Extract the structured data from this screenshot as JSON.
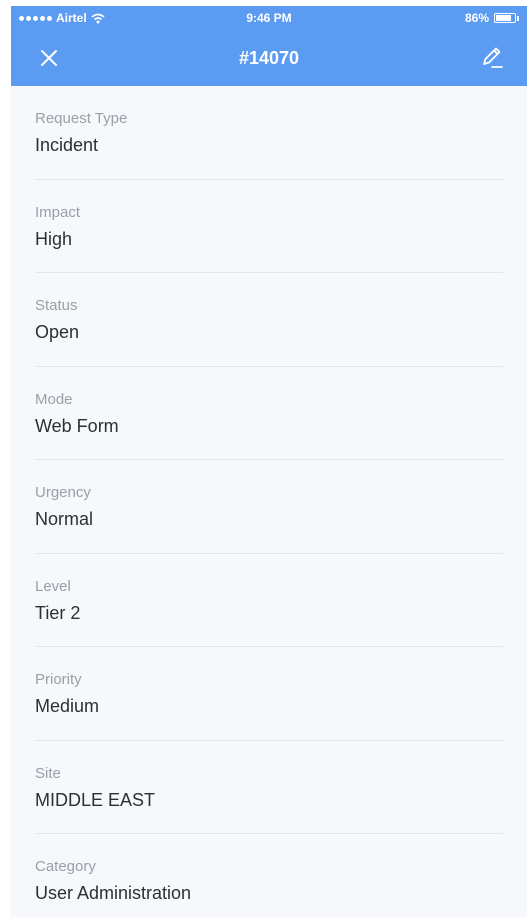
{
  "status_bar": {
    "carrier": "Airtel",
    "time": "9:46 PM",
    "battery": "86%",
    "battery_level": 0.86
  },
  "header": {
    "title": "#14070",
    "close_icon": "close-icon",
    "edit_icon": "edit-icon"
  },
  "fields": [
    {
      "label": "Request Type",
      "value": "Incident"
    },
    {
      "label": "Impact",
      "value": "High"
    },
    {
      "label": "Status",
      "value": "Open"
    },
    {
      "label": "Mode",
      "value": "Web Form"
    },
    {
      "label": "Urgency",
      "value": "Normal"
    },
    {
      "label": "Level",
      "value": "Tier 2"
    },
    {
      "label": "Priority",
      "value": "Medium"
    },
    {
      "label": "Site",
      "value": "MIDDLE EAST"
    },
    {
      "label": "Category",
      "value": "User Administration"
    }
  ],
  "colors": {
    "header": "#5b9cf2",
    "background": "#f7f8fc",
    "label": "#9a9ea8",
    "value": "#2c2f36"
  }
}
